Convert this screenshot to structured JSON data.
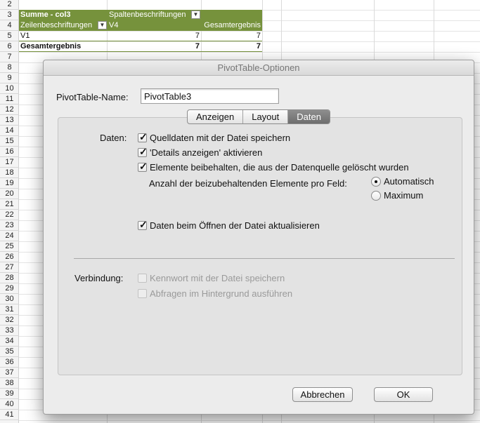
{
  "sheet": {
    "row_numbers": [
      "2",
      "3",
      "4",
      "5",
      "6",
      "7",
      "8",
      "9",
      "10",
      "11",
      "12",
      "13",
      "14",
      "15",
      "16",
      "17",
      "18",
      "19",
      "20",
      "21",
      "22",
      "23",
      "24",
      "25",
      "26",
      "27",
      "28",
      "29",
      "30",
      "31",
      "32",
      "33",
      "34",
      "35",
      "36",
      "37",
      "38",
      "39",
      "40",
      "41"
    ],
    "pivot": {
      "data_field": "Summe - col3",
      "column_labels": "Spaltenbeschriftungen",
      "row_labels": "Zeilenbeschriftungen",
      "col_value": "V4",
      "grand_total_header": "Gesamtergebnis",
      "row_item": "V1",
      "row_item_value": "7",
      "row_item_total": "7",
      "grand_total_label": "Gesamtergebnis",
      "grand_total_value": "7",
      "grand_total_total": "7",
      "dropdown_glyph": "▼"
    },
    "colors": {
      "pivot_header": "#76923c"
    }
  },
  "dialog": {
    "title": "PivotTable-Optionen",
    "name_label": "PivotTable-Name:",
    "name_value": "PivotTable3",
    "tabs": [
      {
        "label": "Anzeigen",
        "active": false
      },
      {
        "label": "Layout",
        "active": false
      },
      {
        "label": "Daten",
        "active": true
      }
    ],
    "daten": {
      "section_label": "Daten:",
      "options": [
        {
          "label": "Quelldaten mit der Datei speichern",
          "checked": true
        },
        {
          "label": "'Details anzeigen' aktivieren",
          "checked": true
        },
        {
          "label": "Elemente beibehalten, die aus der Datenquelle gelöscht wurden",
          "checked": true
        }
      ],
      "retain_label": "Anzahl der beizubehaltenden Elemente pro Feld:",
      "radios": [
        {
          "label": "Automatisch",
          "selected": true
        },
        {
          "label": "Maximum",
          "selected": false
        }
      ],
      "refresh_on_open": {
        "label": "Daten beim Öffnen der Datei aktualisieren",
        "checked": true
      }
    },
    "verbindung": {
      "section_label": "Verbindung:",
      "options": [
        {
          "label": "Kennwort mit der Datei speichern",
          "checked": false,
          "enabled": false
        },
        {
          "label": "Abfragen im Hintergrund ausführen",
          "checked": false,
          "enabled": false
        }
      ]
    },
    "check_glyph": "✓",
    "cancel_label": "Abbrechen",
    "ok_label": "OK"
  }
}
